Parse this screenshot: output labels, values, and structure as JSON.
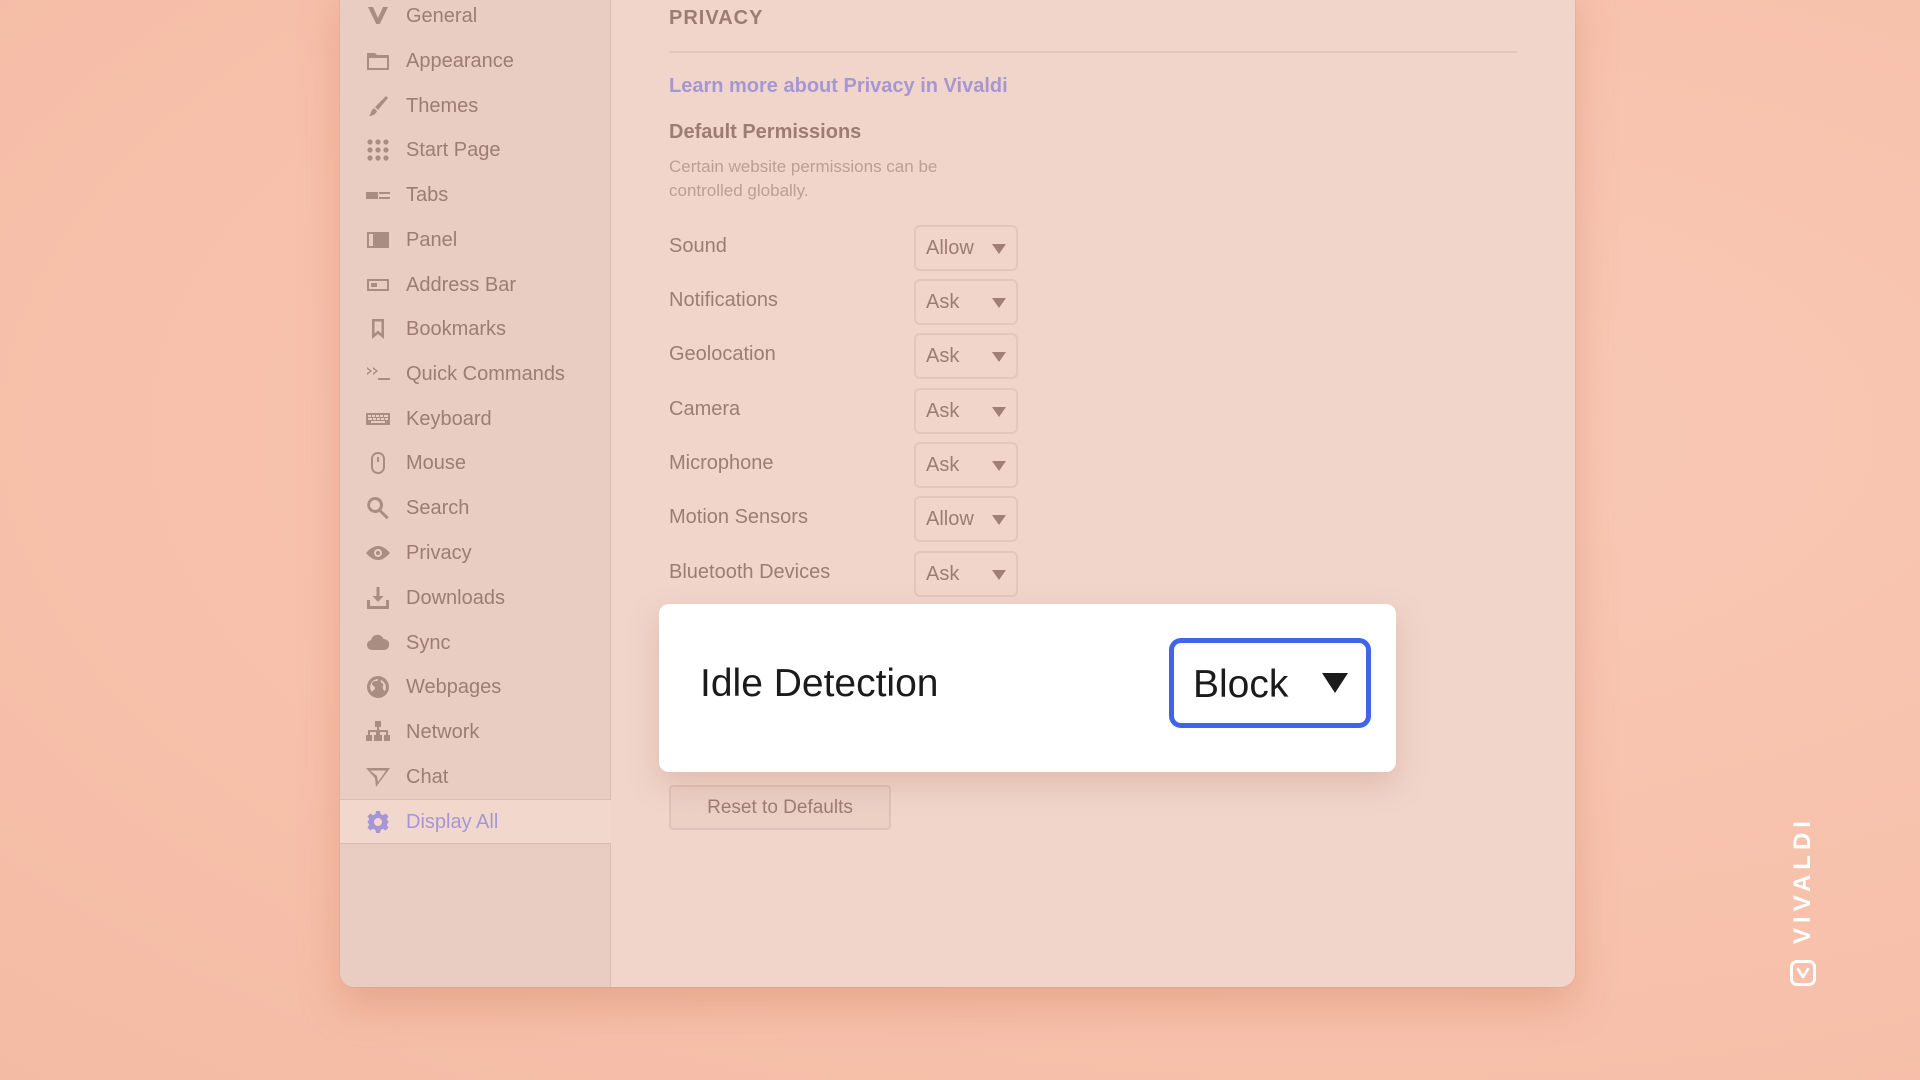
{
  "sidebar": {
    "items": [
      {
        "label": "General",
        "icon": "vivaldi-v-icon"
      },
      {
        "label": "Appearance",
        "icon": "folder-icon"
      },
      {
        "label": "Themes",
        "icon": "brush-icon"
      },
      {
        "label": "Start Page",
        "icon": "grid-icon"
      },
      {
        "label": "Tabs",
        "icon": "tabs-icon"
      },
      {
        "label": "Panel",
        "icon": "panel-icon"
      },
      {
        "label": "Address Bar",
        "icon": "address-bar-icon"
      },
      {
        "label": "Bookmarks",
        "icon": "bookmark-icon"
      },
      {
        "label": "Quick Commands",
        "icon": "quick-commands-icon"
      },
      {
        "label": "Keyboard",
        "icon": "keyboard-icon"
      },
      {
        "label": "Mouse",
        "icon": "mouse-icon"
      },
      {
        "label": "Search",
        "icon": "search-icon"
      },
      {
        "label": "Privacy",
        "icon": "eye-icon"
      },
      {
        "label": "Downloads",
        "icon": "download-icon"
      },
      {
        "label": "Sync",
        "icon": "cloud-icon"
      },
      {
        "label": "Webpages",
        "icon": "globe-icon"
      },
      {
        "label": "Network",
        "icon": "network-icon"
      },
      {
        "label": "Chat",
        "icon": "send-icon"
      },
      {
        "label": "Display All",
        "icon": "gear-icon",
        "active": true
      }
    ]
  },
  "main": {
    "section_title": "PRIVACY",
    "learn_more_link": "Learn more about Privacy in Vivaldi",
    "permissions_heading": "Default Permissions",
    "permissions_description": "Certain website permissions can be controlled globally.",
    "permissions": [
      {
        "label": "Sound",
        "value": "Allow"
      },
      {
        "label": "Notifications",
        "value": "Ask"
      },
      {
        "label": "Geolocation",
        "value": "Ask"
      },
      {
        "label": "Camera",
        "value": "Ask"
      },
      {
        "label": "Microphone",
        "value": "Ask"
      },
      {
        "label": "Motion Sensors",
        "value": "Allow"
      },
      {
        "label": "Bluetooth Devices",
        "value": "Ask"
      }
    ],
    "highlighted_permission": {
      "label": "Idle Detection",
      "value": "Block"
    },
    "reset_button": "Reset to Defaults"
  },
  "brand": {
    "wordmark": "VIVALDI"
  },
  "colors": {
    "background": "#f7c1ab",
    "window": "#f1d5ca",
    "sidebar": "#e9cdc2",
    "accent": "#a497d4",
    "focus_ring": "#3f66e8",
    "text_muted": "#9b7d73"
  }
}
